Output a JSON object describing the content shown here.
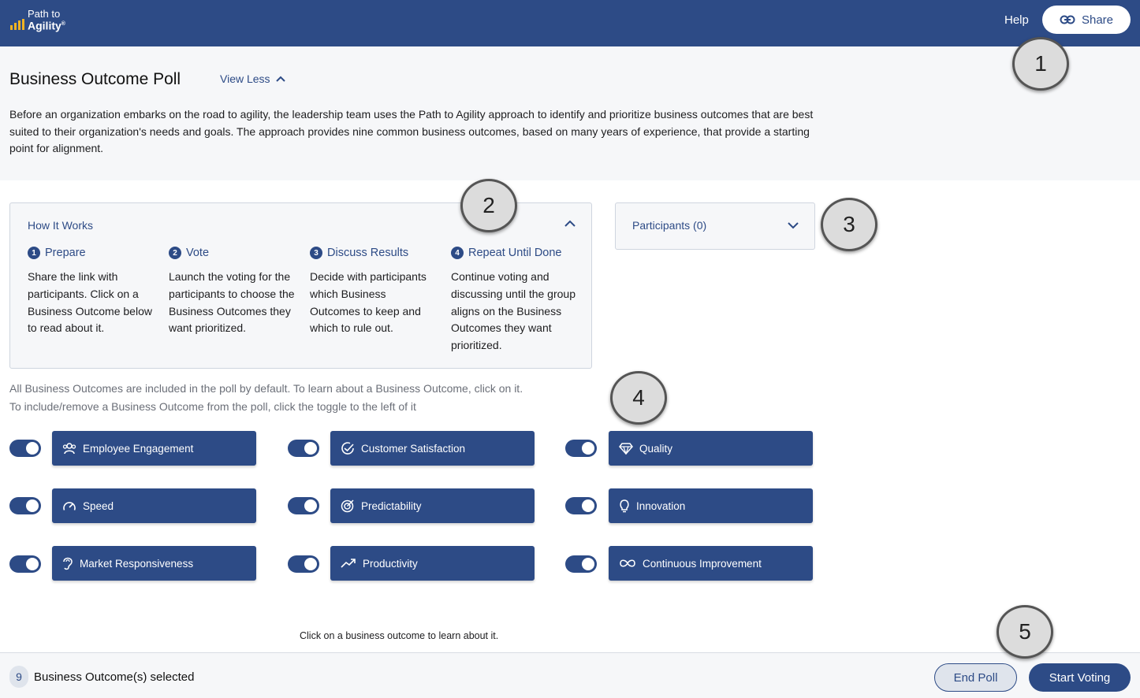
{
  "header": {
    "logo_line1": "Path to",
    "logo_line2": "Agility",
    "logo_reg": "®",
    "help_label": "Help",
    "share_label": "Share"
  },
  "intro": {
    "title": "Business Outcome Poll",
    "view_less_label": "View Less",
    "description": "Before an organization embarks on the road to agility, the leadership team uses the Path to Agility approach to identify and prioritize business outcomes that are best suited to their organization's needs and goals. The approach provides nine common business outcomes, based on many years of experience, that provide a starting point for alignment."
  },
  "how_it_works": {
    "title": "How It Works",
    "steps": [
      {
        "num": "1",
        "title": "Prepare",
        "body": "Share the link with participants. Click on a Business Outcome below to read about it."
      },
      {
        "num": "2",
        "title": "Vote",
        "body": "Launch the voting for the participants to choose the Business Outcomes they want prioritized."
      },
      {
        "num": "3",
        "title": "Discuss Results",
        "body": "Decide with participants which Business Outcomes to keep and which to rule out."
      },
      {
        "num": "4",
        "title": "Repeat Until Done",
        "body": "Continue voting and discussing until the group aligns on the Business Outcomes they want prioritized."
      }
    ]
  },
  "participants": {
    "label": "Participants (0)"
  },
  "instructions": {
    "line1": "All Business Outcomes are included in the poll by default. To learn about a Business Outcome, click on it.",
    "line2": "To include/remove a Business Outcome from the poll, click the toggle to the left of it"
  },
  "outcomes": [
    {
      "label": "Employee Engagement",
      "icon": "people-icon",
      "included": true
    },
    {
      "label": "Customer Satisfaction",
      "icon": "check-circle-icon",
      "included": true
    },
    {
      "label": "Quality",
      "icon": "diamond-icon",
      "included": true
    },
    {
      "label": "Speed",
      "icon": "speedometer-icon",
      "included": true
    },
    {
      "label": "Predictability",
      "icon": "target-icon",
      "included": true
    },
    {
      "label": "Innovation",
      "icon": "lightbulb-icon",
      "included": true
    },
    {
      "label": "Market Responsiveness",
      "icon": "ear-icon",
      "included": true
    },
    {
      "label": "Productivity",
      "icon": "trending-up-icon",
      "included": true
    },
    {
      "label": "Continuous Improvement",
      "icon": "infinity-icon",
      "included": true
    }
  ],
  "click_hint": "Click on a business outcome to learn about it.",
  "footer": {
    "count": "9",
    "count_label": "Business Outcome(s) selected",
    "end_poll_label": "End Poll",
    "start_voting_label": "Start Voting"
  },
  "callouts": [
    "1",
    "2",
    "3",
    "4",
    "5"
  ],
  "colors": {
    "primary": "#2d4b86",
    "logo_accent": "#f0b323",
    "panel_bg": "#f6f7f9"
  }
}
